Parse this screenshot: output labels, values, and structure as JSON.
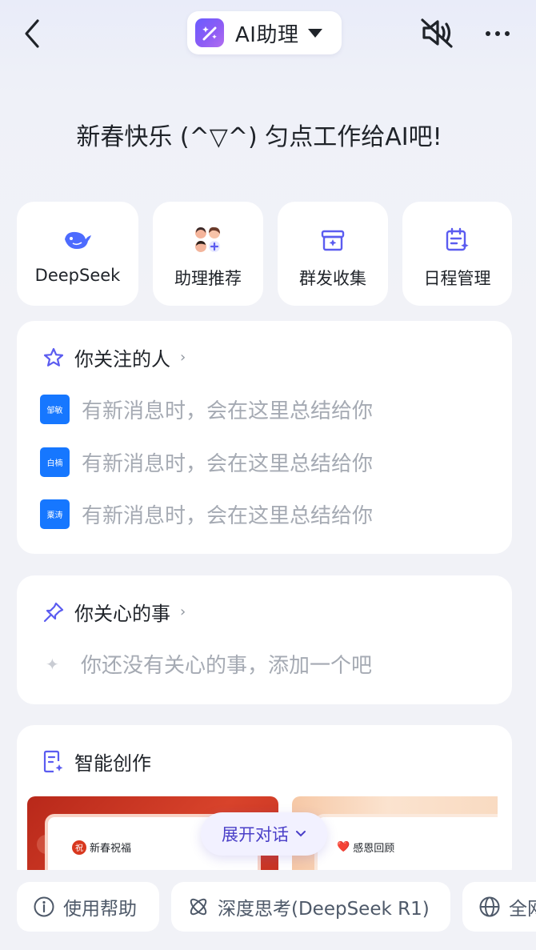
{
  "header": {
    "title": "AI助理",
    "icons": {
      "back": "chevron-left-icon",
      "app": "ai-sparkle-icon",
      "dropdown": "caret-down-icon",
      "mute": "speaker-muted-icon",
      "more": "more-dots-icon"
    }
  },
  "greeting": "新春快乐 (^▽^) 匀点工作给AI吧!",
  "quick_actions": [
    {
      "label": "DeepSeek",
      "icon": "deepseek-whale-icon"
    },
    {
      "label": "助理推荐",
      "icon": "assistant-avatars-icon"
    },
    {
      "label": "群发收集",
      "icon": "collect-box-icon"
    },
    {
      "label": "日程管理",
      "icon": "calendar-sparkle-icon"
    }
  ],
  "followed_people": {
    "title": "你关注的人",
    "icon": "star-icon",
    "rows": [
      {
        "avatar": "邹敏",
        "text": "有新消息时，会在这里总结给你"
      },
      {
        "avatar": "白楠",
        "text": "有新消息时，会在这里总结给你"
      },
      {
        "avatar": "粟涛",
        "text": "有新消息时，会在这里总结给你"
      }
    ]
  },
  "concerns": {
    "title": "你关心的事",
    "icon": "pin-icon",
    "empty_text": "你还没有关心的事，添加一个吧"
  },
  "creation": {
    "title": "智能创作",
    "icon": "doc-sparkle-icon",
    "templates": [
      {
        "label": "新春祝福",
        "badge": "祝"
      },
      {
        "label": "感恩回顾",
        "badge": "❤️"
      }
    ]
  },
  "expand_button": "展开对话",
  "bottom_chips": [
    {
      "label": "使用帮助",
      "icon": "info-icon"
    },
    {
      "label": "深度思考(DeepSeek R1)",
      "icon": "deep-think-icon"
    },
    {
      "label": "全网",
      "icon": "globe-icon"
    }
  ],
  "colors": {
    "accent": "#5b5cf0",
    "avatar_blue": "#1677ff",
    "holiday_red": "#c8311f",
    "muted_text": "#a5aab3"
  }
}
